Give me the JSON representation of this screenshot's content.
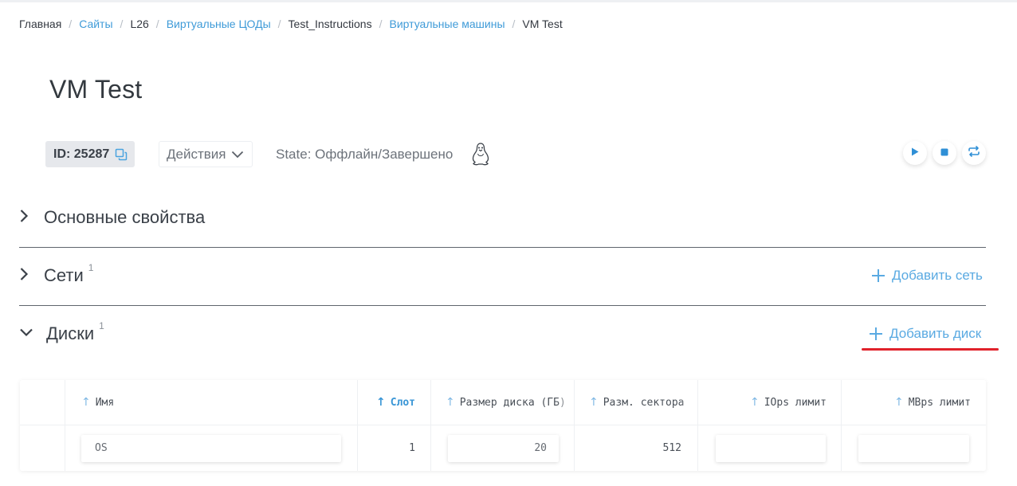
{
  "breadcrumb": [
    {
      "label": "Главная",
      "link": false
    },
    {
      "label": "Сайты",
      "link": true
    },
    {
      "label": "L26",
      "link": false
    },
    {
      "label": "Виртуальные ЦОДы",
      "link": true
    },
    {
      "label": "Test_Instructions",
      "link": false
    },
    {
      "label": "Виртуальные машины",
      "link": true
    },
    {
      "label": "VM Test",
      "link": false
    }
  ],
  "page": {
    "title": "VM Test"
  },
  "toolbar": {
    "id_label": "ID: 25287",
    "actions_label": "Действия",
    "state_text": "State: Оффлайн/Завершено",
    "os_icon": "linux-tux-icon",
    "controls": [
      "play-icon",
      "stop-icon",
      "restart-icon"
    ]
  },
  "sections": {
    "main": {
      "title": "Основные свойства"
    },
    "networks": {
      "title": "Сети",
      "count": "1",
      "add_label": "Добавить сеть"
    },
    "disks": {
      "title": "Диски",
      "count": "1",
      "add_label": "Добавить диск"
    }
  },
  "disks_table": {
    "columns": [
      "Имя",
      "Слот",
      "Размер диска (ГБ)",
      "Разм. сектора",
      "IOps лимит",
      "MBps лимит"
    ],
    "sorted_column": "Слот",
    "rows": [
      {
        "name": "OS",
        "slot": "1",
        "size": "20",
        "sector": "512",
        "iops": "",
        "mbps": ""
      }
    ]
  },
  "colors": {
    "accent": "#3f9bd8",
    "highlight": "#e0222b",
    "text": "#333840"
  }
}
